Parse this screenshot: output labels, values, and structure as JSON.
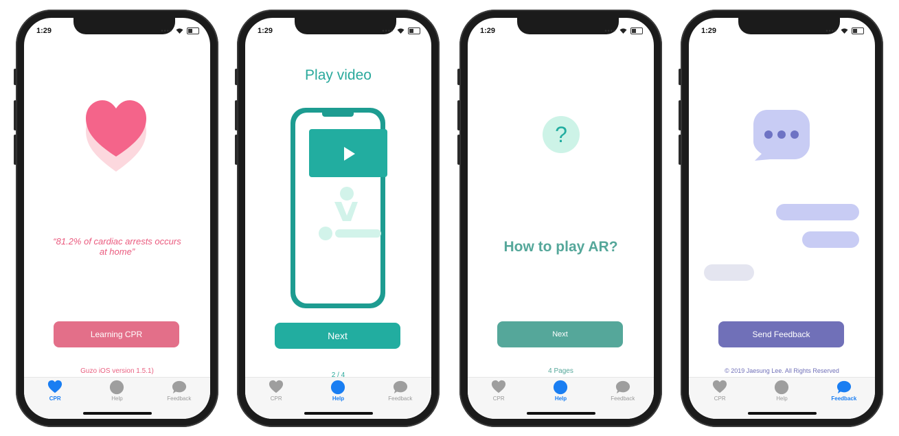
{
  "status": {
    "time": "1:29"
  },
  "tabs": [
    {
      "label": "CPR",
      "icon": "heart-icon"
    },
    {
      "label": "Help",
      "icon": "circle-icon"
    },
    {
      "label": "Feedback",
      "icon": "chat-bubble-icon"
    }
  ],
  "screen1": {
    "quote": "“81.2% of cardiac arrests occurs at home”",
    "button": "Learning CPR",
    "version": "Guzo iOS version 1.5.1)",
    "active_tab": "CPR"
  },
  "screen2": {
    "title": "Play video",
    "button": "Next",
    "page": "2 / 4",
    "active_tab": "Help"
  },
  "screen3": {
    "title": "How to play AR?",
    "button": "Next",
    "pages": "4 Pages",
    "active_tab": "Help"
  },
  "screen4": {
    "button": "Send Feedback",
    "copyright": "© 2019 Jaesung Lee. All Rights Reserved",
    "active_tab": "Feedback"
  },
  "colors": {
    "pink": "#f06a8a",
    "teal": "#22ada0",
    "teal_button": "#55a79a",
    "purple": "#7070b8",
    "lavender": "#c8ccf4",
    "active_blue": "#1a7ef2"
  }
}
